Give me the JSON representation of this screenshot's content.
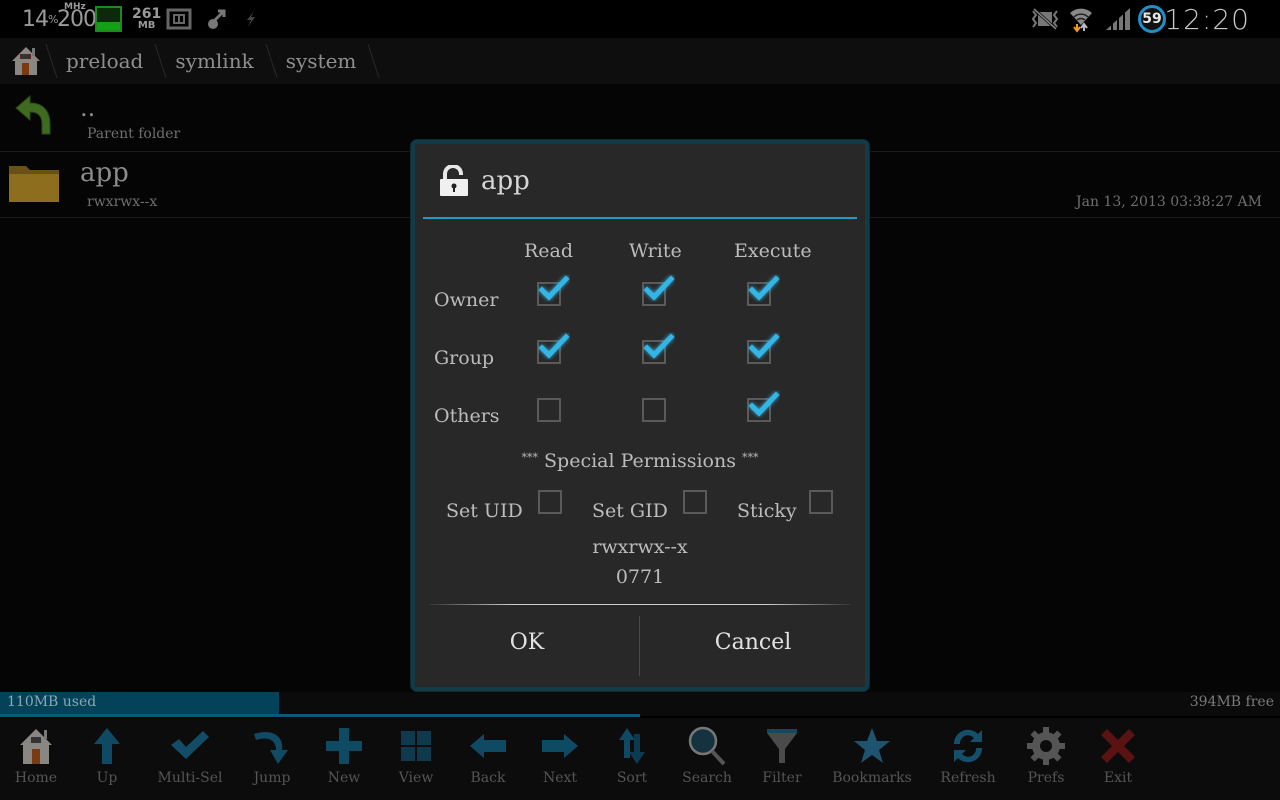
{
  "status_bar": {
    "cpu_percent": "14",
    "cpu_percent_unit": "%",
    "cpu_freq": "200",
    "cpu_freq_unit": "MHz",
    "battery_level_fraction": 0.35,
    "memory_value": "261",
    "memory_unit": "MB",
    "icons": [
      "cpu-usage-icon",
      "cpu-freq-icon",
      "battery-widget-icon",
      "memory-icon",
      "screenshot-frame-icon",
      "usb-debug-icon",
      "charging-bolt-icon",
      "vibrate-mute-icon",
      "wifi-icon",
      "signal-icon"
    ],
    "notification_badge": "59",
    "clock": "12:20"
  },
  "breadcrumb": {
    "home_icon": "house-icon",
    "items": [
      "preload",
      "symlink",
      "system"
    ]
  },
  "file_list": {
    "parent": {
      "name": "..",
      "subtitle": "Parent folder",
      "icon": "back-arrow-icon"
    },
    "items": [
      {
        "name": "app",
        "permissions": "rwxrwx--x",
        "date": "Jan 13, 2013 03:38:27 AM",
        "icon": "folder-icon"
      }
    ]
  },
  "storage": {
    "used_label": "110MB used",
    "free_label": "394MB free",
    "used_fraction": 0.218
  },
  "toolbar": {
    "buttons": [
      {
        "label": "Home",
        "icon": "house-icon"
      },
      {
        "label": "Up",
        "icon": "arrow-up-icon"
      },
      {
        "label": "Multi-Sel",
        "icon": "checkmark-icon"
      },
      {
        "label": "Jump",
        "icon": "curved-arrow-icon"
      },
      {
        "label": "New",
        "icon": "plus-icon"
      },
      {
        "label": "View",
        "icon": "grid-icon"
      },
      {
        "label": "Back",
        "icon": "arrow-left-icon"
      },
      {
        "label": "Next",
        "icon": "arrow-right-icon"
      },
      {
        "label": "Sort",
        "icon": "sort-arrows-icon"
      },
      {
        "label": "Search",
        "icon": "magnifier-icon"
      },
      {
        "label": "Filter",
        "icon": "funnel-icon"
      },
      {
        "label": "Bookmarks",
        "icon": "star-icon"
      },
      {
        "label": "Refresh",
        "icon": "refresh-icon"
      },
      {
        "label": "Prefs",
        "icon": "gear-icon"
      },
      {
        "label": "Exit",
        "icon": "x-icon"
      }
    ]
  },
  "dialog": {
    "title": "app",
    "title_icon": "unlock-icon",
    "columns": [
      "Read",
      "Write",
      "Execute"
    ],
    "rows": [
      {
        "label": "Owner",
        "values": [
          true,
          true,
          true
        ]
      },
      {
        "label": "Group",
        "values": [
          true,
          true,
          true
        ]
      },
      {
        "label": "Others",
        "values": [
          false,
          false,
          true
        ]
      }
    ],
    "special_title_prefix": "***",
    "special_title": "Special Permissions",
    "special_title_suffix": "***",
    "special": [
      {
        "label": "Set UID",
        "checked": false
      },
      {
        "label": "Set GID",
        "checked": false
      },
      {
        "label": "Sticky",
        "checked": false
      }
    ],
    "permission_string": "rwxrwx--x",
    "permission_octal": "0771",
    "ok_label": "OK",
    "cancel_label": "Cancel"
  },
  "colors": {
    "accent": "#1f9ad0",
    "checkmark": "#33b5e5",
    "dialog_bg": "#282828",
    "dialog_border": "#123a48",
    "storage_used": "#034258"
  }
}
